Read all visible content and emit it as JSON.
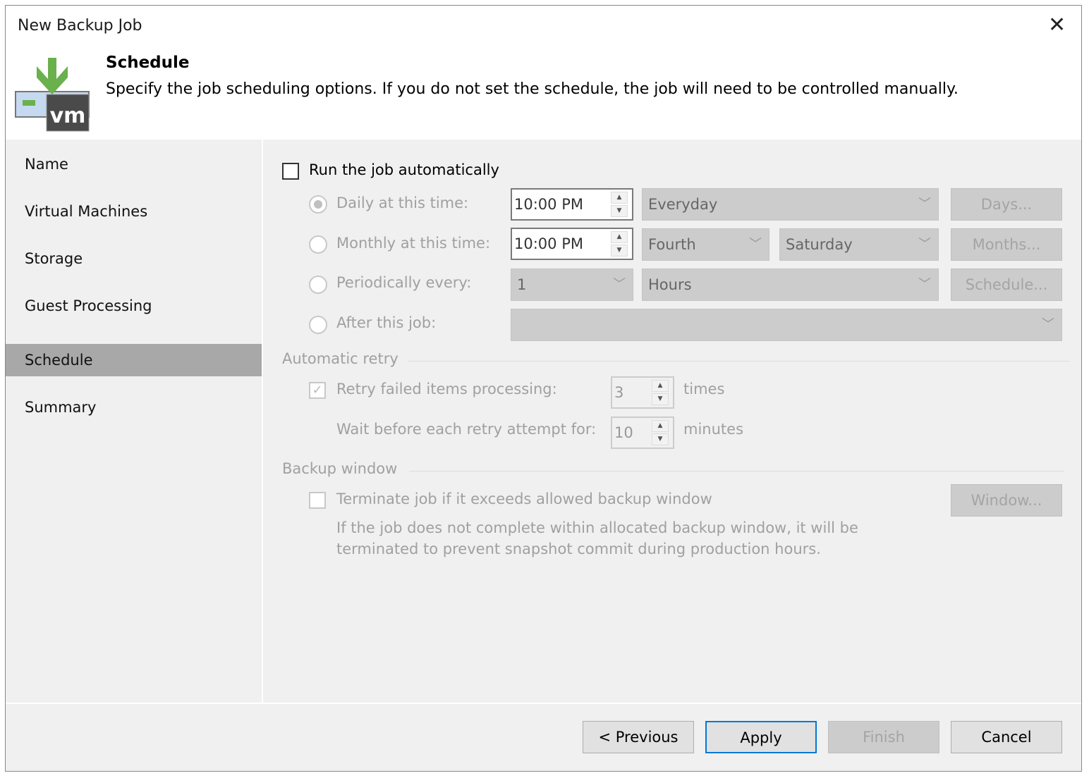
{
  "window": {
    "title": "New Backup Job",
    "close_icon": "close-icon"
  },
  "header": {
    "title": "Schedule",
    "description": "Specify the job scheduling options. If you do not set the schedule, the job will need to be controlled manually.",
    "icon": "vm-backup-icon"
  },
  "nav": {
    "items": [
      {
        "label": "Name"
      },
      {
        "label": "Virtual Machines"
      },
      {
        "label": "Storage"
      },
      {
        "label": "Guest Processing"
      },
      {
        "label": "Schedule",
        "selected": true
      },
      {
        "label": "Summary"
      }
    ]
  },
  "schedule": {
    "run_auto": {
      "label": "Run the job automatically",
      "checked": false
    },
    "daily": {
      "label": "Daily at this time:",
      "selected": true,
      "time": "10:00 PM",
      "days": "Everyday",
      "button": "Days..."
    },
    "monthly": {
      "label": "Monthly at this time:",
      "time": "10:00 PM",
      "week": "Fourth",
      "day": "Saturday",
      "button": "Months..."
    },
    "periodic": {
      "label": "Periodically every:",
      "value": "1",
      "unit": "Hours",
      "button": "Schedule..."
    },
    "after": {
      "label": "After this job:",
      "value": ""
    }
  },
  "retry": {
    "group": "Automatic retry",
    "retry_label": "Retry failed items processing:",
    "retry_checked": true,
    "retry_count": "3",
    "times": "times",
    "wait_label": "Wait before each retry attempt for:",
    "wait_value": "10",
    "minutes": "minutes"
  },
  "window_group": {
    "group": "Backup window",
    "terminate_label": "Terminate job if it exceeds allowed backup window",
    "terminate_checked": false,
    "button": "Window...",
    "note1": "If the job does not complete within allocated backup window, it will be",
    "note2": "terminated to prevent snapshot commit during production hours."
  },
  "footer": {
    "previous": "< Previous",
    "apply": "Apply",
    "finish": "Finish",
    "cancel": "Cancel"
  }
}
